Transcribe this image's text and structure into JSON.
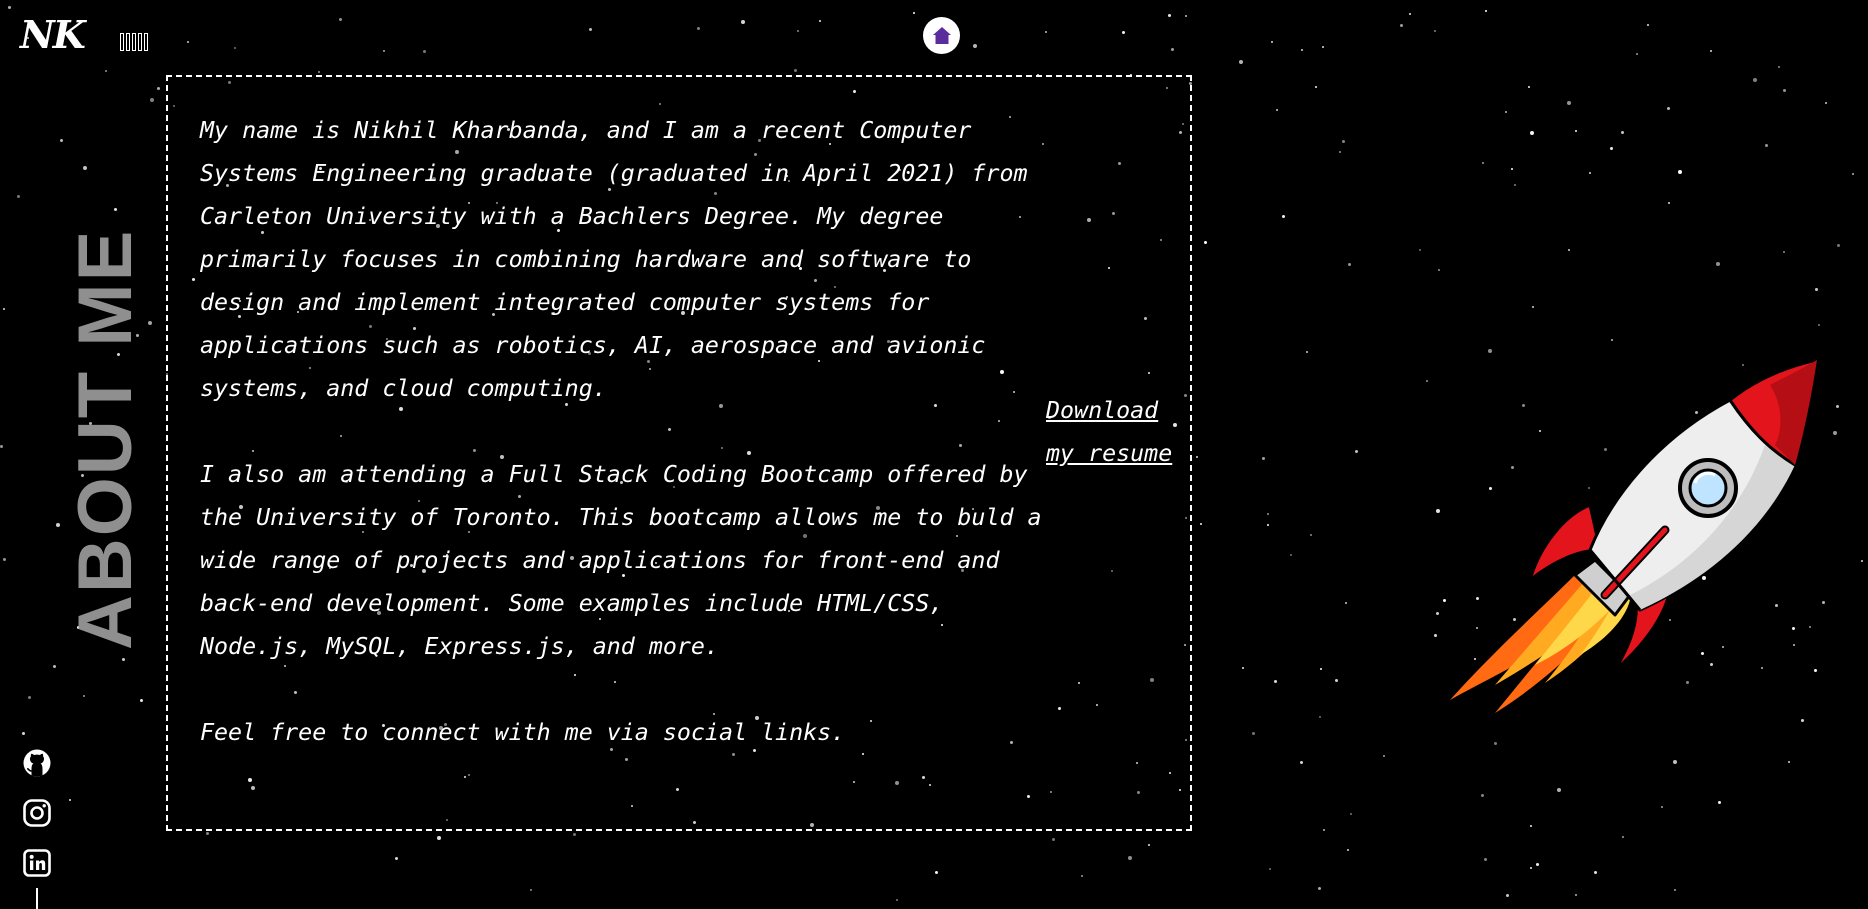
{
  "brand": {
    "logo_text": "NK"
  },
  "nav": {
    "home_icon": "home-icon"
  },
  "page": {
    "title": "ABOUT ME"
  },
  "about": {
    "paragraphs": [
      "My name is Nikhil Kharbanda, and I am a recent Computer Systems Engineering graduate (graduated in April 2021) from Carleton University with a Bachlers Degree. My degree primarily focuses in combining hardware and software to design and implement integrated computer systems for applications such as robotics, AI, aerospace and avionic systems, and cloud computing.",
      "I also am attending a Full Stack Coding Bootcamp offered by the University of Toronto. This bootcamp allows me to buld a wide range of projects and applications for front-end and back-end development. Some examples include HTML/CSS, Node.js, MySQL, Express.js, and more.",
      "Feel free to connect with me via social links."
    ],
    "resume_link": "Download my resume"
  },
  "socials": [
    {
      "name": "github",
      "icon": "github-icon"
    },
    {
      "name": "instagram",
      "icon": "instagram-icon"
    },
    {
      "name": "linkedin",
      "icon": "linkedin-icon"
    }
  ],
  "colors": {
    "background": "#000000",
    "text": "#ffffff",
    "title": "#8f8f8f",
    "home_icon": "#5b2d9c",
    "rocket_nose": "#e3141c",
    "rocket_body": "#eeeeee",
    "flame": "#ff8a1c"
  }
}
